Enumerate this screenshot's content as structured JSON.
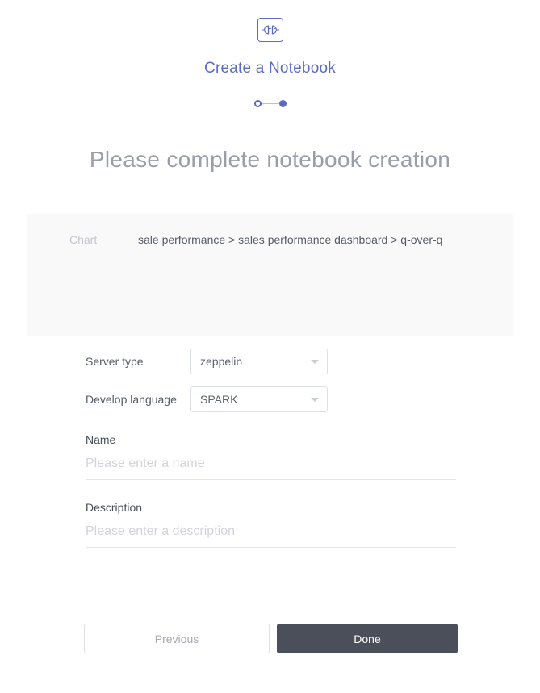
{
  "header": {
    "icon_name": "plug-connector-icon",
    "wizard_title": "Create a Notebook"
  },
  "stepper": {
    "steps": [
      {
        "label": "",
        "state": "done"
      },
      {
        "label": "",
        "state": "current"
      }
    ]
  },
  "headline": "Please complete notebook creation",
  "summary": {
    "label": "Chart",
    "value": "sale performance > sales performance dashboard > q-over-q"
  },
  "form": {
    "server_type": {
      "label": "Server type",
      "value": "zeppelin"
    },
    "develop_language": {
      "label": "Develop language",
      "value": "SPARK"
    },
    "name": {
      "label": "Name",
      "value": "",
      "placeholder": "Please enter a name"
    },
    "description": {
      "label": "Description",
      "value": "",
      "placeholder": "Please enter a description"
    }
  },
  "actions": {
    "previous_label": "Previous",
    "done_label": "Done"
  },
  "colors": {
    "accent": "#5b6bbf",
    "headline": "#9a9ea8",
    "panel_bg": "#f9f9fa",
    "done_button": "#4a4f5a",
    "muted_text": "#c3c6cc"
  }
}
